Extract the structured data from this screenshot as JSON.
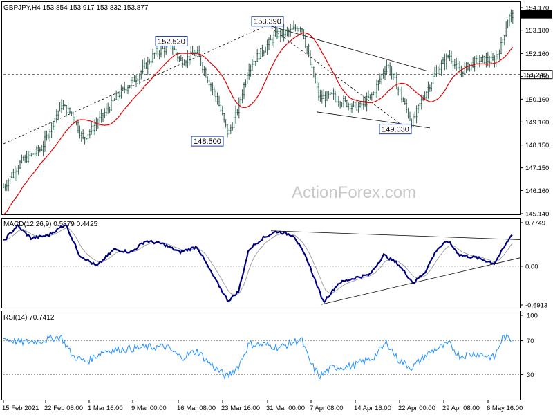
{
  "chart_data": [
    {
      "panel": "price",
      "type": "candlestick",
      "title": "GBPJPY,H4",
      "ohlc": [
        "153.854",
        "153.917",
        "153.832",
        "153.877"
      ],
      "watermark": "ActionForex.com",
      "ylim": [
        145.14,
        154.17
      ],
      "yticks": [
        "154.170",
        "153.180",
        "152.160",
        "151.150",
        "150.160",
        "149.160",
        "148.150",
        "147.150",
        "146.160",
        "145.140"
      ],
      "last_price": "153.877",
      "last_price_color": "#000000",
      "marked_level": "151.240",
      "annotations": [
        {
          "text": "153.390",
          "value": 153.39,
          "x": "31 Mar 00:00"
        },
        {
          "text": "152.520",
          "value": 152.52,
          "x": "26 Feb 12:00"
        },
        {
          "text": "148.500",
          "value": 148.5,
          "x": "24 Mar 04:00"
        },
        {
          "text": "149.030",
          "value": 149.03,
          "x": "22 Apr 08:00"
        }
      ],
      "series": [
        {
          "name": "",
          "kind": "candles",
          "color": "#2f5f4f"
        },
        {
          "name": "",
          "kind": "moving-average",
          "color": "#e00000"
        }
      ],
      "trendlines": [
        {
          "style": "dashed",
          "from": [
            "15 Feb 2021",
            148.2
          ],
          "to": [
            "31 Mar 00:00",
            153.4
          ]
        },
        {
          "style": "dashed",
          "from": [
            "31 Mar 00:00",
            153.4
          ],
          "to": [
            "22 Apr 00:00",
            149.1
          ]
        },
        {
          "style": "solid",
          "from": [
            "31 Mar 00:00",
            153.4
          ],
          "to": [
            "26 Apr 16:00",
            151.4
          ]
        },
        {
          "style": "solid",
          "from": [
            "1 Apr 16:00",
            149.6
          ],
          "to": [
            "24 Apr 08:00",
            148.9
          ]
        }
      ]
    },
    {
      "panel": "macd",
      "type": "line",
      "title": "MACD(12,26,9) 0.5879 0.4425",
      "ylim": [
        -0.6913,
        0.7749
      ],
      "yticks": [
        "0.7749",
        "0.00",
        "-0.6913"
      ],
      "series": [
        {
          "name": "",
          "color": "#00007f"
        },
        {
          "name": "",
          "color": "#a0a0a0"
        }
      ],
      "trendlines": [
        {
          "from": [
            "31 Mar 00:00",
            0.63
          ],
          "to": [
            "6 May 16:00",
            0.49
          ]
        },
        {
          "from": [
            "7 Apr 08:00",
            -0.68
          ],
          "to": [
            "6 May 16:00",
            0.06
          ]
        }
      ]
    },
    {
      "panel": "rsi",
      "type": "line",
      "title": "RSI(14) 70.7412",
      "ylim": [
        0,
        100
      ],
      "yticks": [
        "100",
        "70",
        "30",
        "0"
      ],
      "levels": [
        70,
        30
      ],
      "series": [
        {
          "name": "",
          "color": "#1e90ff"
        }
      ]
    }
  ],
  "x_axis": {
    "tick_labels": [
      "15 Feb 2021",
      "22 Feb 08:00",
      "1 Mar 16:00",
      "9 Mar 00:00",
      "16 Mar 08:00",
      "23 Mar 16:00",
      "31 Mar 00:00",
      "7 Apr 08:00",
      "14 Apr 16:00",
      "22 Apr 00:00",
      "29 Apr 08:00",
      "6 May 16:00"
    ]
  },
  "colors": {
    "candle": "#2f5f4f",
    "ma": "#e00000",
    "macd": "#00007f",
    "signal": "#a0a0a0",
    "rsi": "#1e90ff",
    "level_line": "#404040",
    "grid_dots": "#9a9a9a"
  }
}
